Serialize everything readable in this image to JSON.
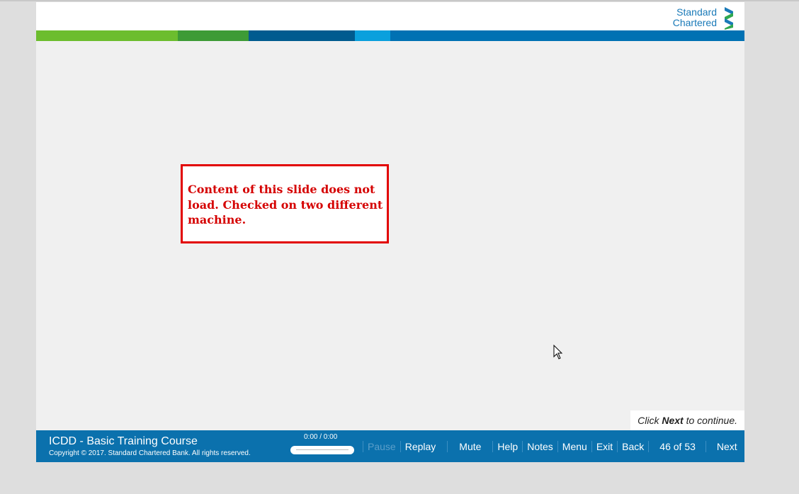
{
  "brand": {
    "logo_line1": "Standard",
    "logo_line2": "Chartered",
    "logo_colors": [
      "#1a7ab8",
      "#2fa84f"
    ]
  },
  "stripe_colors": [
    "#6cbd2e",
    "#3d9b36",
    "#005b8f",
    "#0aa0dd",
    "#0071b3"
  ],
  "annotation": {
    "text": "Content of this slide does not load. Checked on two different machine.",
    "border_color": "#e20000",
    "text_color": "#d50000"
  },
  "continue_hint": {
    "prefix": "Click",
    "emphasis": "Next",
    "suffix": "to continue."
  },
  "footer": {
    "course_title": "ICDD - Basic Training Course",
    "copyright": "Copyright © 2017. Standard Chartered Bank. All rights reserved.",
    "time": "0:00 / 0:00",
    "progress": 0,
    "buttons": {
      "pause": "Pause",
      "replay": "Replay",
      "mute": "Mute",
      "help": "Help",
      "notes": "Notes",
      "menu": "Menu",
      "exit": "Exit",
      "back": "Back",
      "next": "Next"
    },
    "page_counter": "46 of 53",
    "background_color": "#0b71ad"
  },
  "icons": {
    "cursor": "mouse-pointer-icon",
    "logo": "standard-chartered-logo-icon"
  }
}
